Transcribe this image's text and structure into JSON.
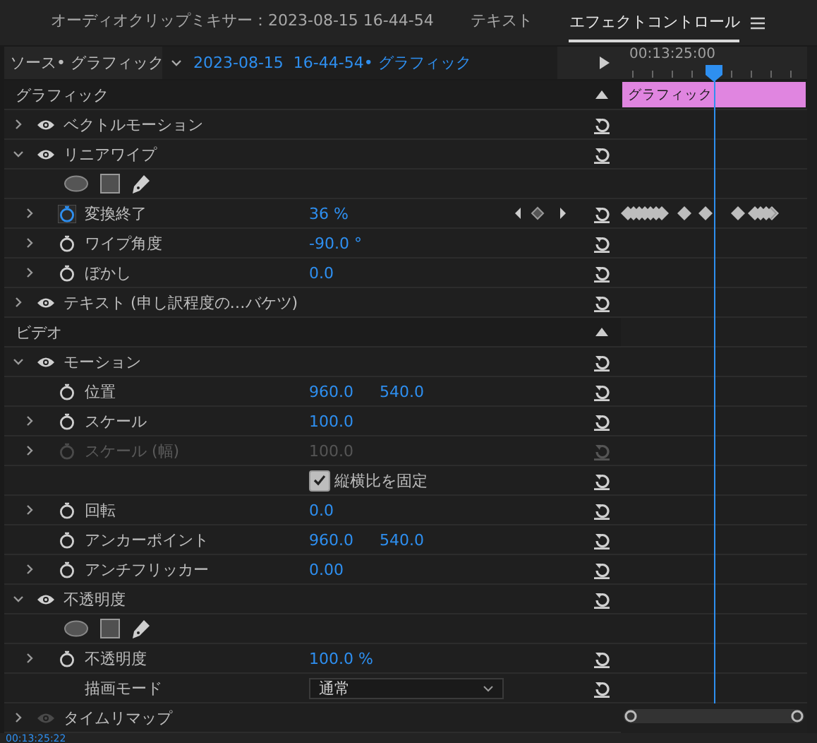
{
  "tabs": [
    {
      "label": "オーディオクリップミキサー：2023-08-15 16-44-54",
      "selected": false
    },
    {
      "label": "テキスト",
      "selected": false
    },
    {
      "label": "エフェクトコントロール",
      "selected": true
    }
  ],
  "header": {
    "source": "ソース• グラフィック",
    "clip": "2023-08-15  16-44-54• グラフィック",
    "timecode": "00:13:25:00"
  },
  "rows": [
    {
      "kind": "section",
      "label": "グラフィック",
      "clip": "グラフィック"
    },
    {
      "kind": "effect",
      "label": "ベクトルモーション",
      "expanded": false,
      "enabled": true
    },
    {
      "kind": "effect",
      "label": "リニアワイプ",
      "expanded": true,
      "enabled": true
    },
    {
      "kind": "mask_tools"
    },
    {
      "kind": "property",
      "label": "変換終了",
      "values": [
        "36 %"
      ],
      "expandable": true,
      "animated": true,
      "disabled": false,
      "keyframes": true
    },
    {
      "kind": "property",
      "label": "ワイプ角度",
      "values": [
        "-90.0 °"
      ],
      "expandable": true,
      "animated": false,
      "disabled": false,
      "keyframes": false
    },
    {
      "kind": "property",
      "label": "ぼかし",
      "values": [
        "0.0"
      ],
      "expandable": true,
      "animated": false,
      "disabled": false,
      "keyframes": false
    },
    {
      "kind": "effect",
      "label": "テキスト (申し訳程度の…バケツ)",
      "expanded": false,
      "enabled": true
    },
    {
      "kind": "section",
      "label": "ビデオ"
    },
    {
      "kind": "effect",
      "label": "モーション",
      "expanded": true,
      "enabled": true
    },
    {
      "kind": "property",
      "label": "位置",
      "values": [
        "960.0",
        "540.0"
      ],
      "expandable": false,
      "animated": false,
      "disabled": false,
      "keyframes": false
    },
    {
      "kind": "property",
      "label": "スケール",
      "values": [
        "100.0"
      ],
      "expandable": true,
      "animated": false,
      "disabled": false,
      "keyframes": false
    },
    {
      "kind": "property",
      "label": "スケール (幅)",
      "values": [
        "100.0"
      ],
      "expandable": true,
      "animated": false,
      "disabled": true,
      "keyframes": false
    },
    {
      "kind": "checkbox",
      "label": "縦横比を固定",
      "checked": true
    },
    {
      "kind": "property",
      "label": "回転",
      "values": [
        "0.0"
      ],
      "expandable": true,
      "animated": false,
      "disabled": false,
      "keyframes": false
    },
    {
      "kind": "property",
      "label": "アンカーポイント",
      "values": [
        "960.0",
        "540.0"
      ],
      "expandable": false,
      "animated": false,
      "disabled": false,
      "keyframes": false
    },
    {
      "kind": "property",
      "label": "アンチフリッカー",
      "values": [
        "0.00"
      ],
      "expandable": true,
      "animated": false,
      "disabled": false,
      "keyframes": false
    },
    {
      "kind": "effect",
      "label": "不透明度",
      "expanded": true,
      "enabled": true
    },
    {
      "kind": "mask_tools"
    },
    {
      "kind": "property",
      "label": "不透明度",
      "values": [
        "100.0 %"
      ],
      "expandable": true,
      "animated": false,
      "disabled": false,
      "keyframes": false
    },
    {
      "kind": "dropdown",
      "label": "描画モード",
      "value": "通常"
    },
    {
      "kind": "effect",
      "label": "タイムリマップ",
      "expanded": false,
      "enabled": false,
      "noreset": true
    }
  ],
  "footer_timecode": "00:13:25:22"
}
